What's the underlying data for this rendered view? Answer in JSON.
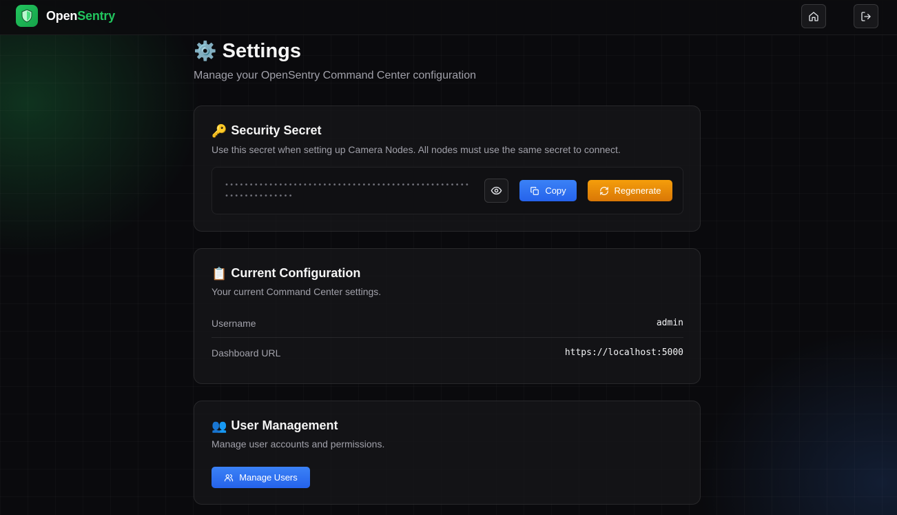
{
  "header": {
    "brand_part1": "Open",
    "brand_part2": "Sentry",
    "logo_icon": "shield-icon",
    "home_icon": "home-icon",
    "logout_icon": "logout-icon",
    "accent": "#22c55e"
  },
  "page": {
    "title_emoji": "⚙️",
    "title": "Settings",
    "subtitle": "Manage your OpenSentry Command Center configuration"
  },
  "security": {
    "emoji": "🔑",
    "title": "Security Secret",
    "description": "Use this secret when setting up Camera Nodes. All nodes must use the same secret to connect.",
    "masked_secret": "••••••••••••••••••••••••••••••••••••••••••••••••••••••••••••••••",
    "reveal_icon": "eye-icon",
    "copy_label": "Copy",
    "copy_icon": "copy-icon",
    "regenerate_label": "Regenerate",
    "regenerate_icon": "refresh-icon",
    "copy_color": "#3b82f6",
    "regenerate_color": "#f59e0b"
  },
  "config": {
    "emoji": "📋",
    "title": "Current Configuration",
    "description": "Your current Command Center settings.",
    "rows": [
      {
        "label": "Username",
        "value": "admin"
      },
      {
        "label": "Dashboard URL",
        "value": "https://localhost:5000"
      }
    ]
  },
  "users": {
    "emoji": "👥",
    "title": "User Management",
    "description": "Manage user accounts and permissions.",
    "manage_label": "Manage Users",
    "manage_icon": "users-icon"
  }
}
